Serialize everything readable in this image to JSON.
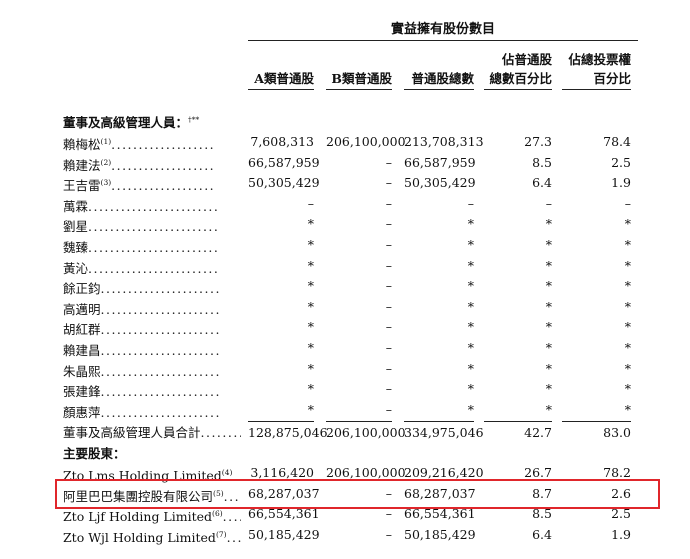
{
  "header": {
    "group_title": "實益擁有股份數目",
    "columns": [
      {
        "line1": "",
        "line2": "A類普通股"
      },
      {
        "line1": "",
        "line2": "B類普通股"
      },
      {
        "line1": "",
        "line2": "普通股總數"
      },
      {
        "line1": "佔普通股",
        "line2": "總數百分比"
      },
      {
        "line1": "佔總投票權",
        "line2": "百分比"
      }
    ]
  },
  "sections": {
    "directors_title": "董事及高級管理人員：",
    "directors_title_sup": "†**",
    "shareholders_title": "主要股東："
  },
  "rows": [
    {
      "label": "賴梅松",
      "sup": "(1)",
      "dots": "...................",
      "a": "7,608,313",
      "b": "206,100,000",
      "total": "213,708,313",
      "pct_shares": "27.3",
      "pct_votes": "78.4"
    },
    {
      "label": "賴建法",
      "sup": "(2)",
      "dots": "...................",
      "a": "66,587,959",
      "b": "–",
      "total": "66,587,959",
      "pct_shares": "8.5",
      "pct_votes": "2.5"
    },
    {
      "label": "王吉雷",
      "sup": "(3)",
      "dots": "...................",
      "a": "50,305,429",
      "b": "–",
      "total": "50,305,429",
      "pct_shares": "6.4",
      "pct_votes": "1.9"
    },
    {
      "label": "萬霖",
      "sup": "",
      "dots": "........................",
      "a": "–",
      "b": "–",
      "total": "–",
      "pct_shares": "–",
      "pct_votes": "–"
    },
    {
      "label": "劉星",
      "sup": "",
      "dots": "........................",
      "a": "*",
      "b": "–",
      "total": "*",
      "pct_shares": "*",
      "pct_votes": "*"
    },
    {
      "label": "魏臻",
      "sup": "",
      "dots": "........................",
      "a": "*",
      "b": "–",
      "total": "*",
      "pct_shares": "*",
      "pct_votes": "*"
    },
    {
      "label": "黃沁",
      "sup": "",
      "dots": "........................",
      "a": "*",
      "b": "–",
      "total": "*",
      "pct_shares": "*",
      "pct_votes": "*"
    },
    {
      "label": "餘正鈞",
      "sup": "",
      "dots": "......................",
      "a": "*",
      "b": "–",
      "total": "*",
      "pct_shares": "*",
      "pct_votes": "*"
    },
    {
      "label": "高邁明",
      "sup": "",
      "dots": "......................",
      "a": "*",
      "b": "–",
      "total": "*",
      "pct_shares": "*",
      "pct_votes": "*"
    },
    {
      "label": "胡紅群",
      "sup": "",
      "dots": "......................",
      "a": "*",
      "b": "–",
      "total": "*",
      "pct_shares": "*",
      "pct_votes": "*"
    },
    {
      "label": "賴建昌",
      "sup": "",
      "dots": "......................",
      "a": "*",
      "b": "–",
      "total": "*",
      "pct_shares": "*",
      "pct_votes": "*"
    },
    {
      "label": "朱晶熙",
      "sup": "",
      "dots": "......................",
      "a": "*",
      "b": "–",
      "total": "*",
      "pct_shares": "*",
      "pct_votes": "*"
    },
    {
      "label": "張建鋒",
      "sup": "",
      "dots": "......................",
      "a": "*",
      "b": "–",
      "total": "*",
      "pct_shares": "*",
      "pct_votes": "*"
    },
    {
      "label": "顏惠萍",
      "sup": "",
      "dots": "......................",
      "a": "*",
      "b": "–",
      "total": "*",
      "pct_shares": "*",
      "pct_votes": "*"
    }
  ],
  "total_row": {
    "label": "董事及高級管理人員合計",
    "dots": "........",
    "a": "128,875,046",
    "b": "206,100,000",
    "total": "334,975,046",
    "pct_shares": "42.7",
    "pct_votes": "83.0"
  },
  "shareholder_rows": [
    {
      "label": "Zto Lms Holding Limited",
      "sup": "(4)",
      "dots": "",
      "a": "3,116,420",
      "b": "206,100,000",
      "total": "209,216,420",
      "pct_shares": "26.7",
      "pct_votes": "78.2"
    },
    {
      "label": "阿里巴巴集團控股有限公司",
      "sup": "(5)",
      "dots": "....",
      "a": "68,287,037",
      "b": "–",
      "total": "68,287,037",
      "pct_shares": "8.7",
      "pct_votes": "2.6"
    },
    {
      "label": "Zto Ljf Holding Limited",
      "sup": "(6)",
      "dots": ".......",
      "a": "66,554,361",
      "b": "–",
      "total": "66,554,361",
      "pct_shares": "8.5",
      "pct_votes": "2.5"
    },
    {
      "label": "Zto Wjl Holding Limited",
      "sup": "(7)",
      "dots": ".......",
      "a": "50,185,429",
      "b": "–",
      "total": "50,185,429",
      "pct_shares": "6.4",
      "pct_votes": "1.9"
    }
  ],
  "highlight_color": "#e0262b"
}
